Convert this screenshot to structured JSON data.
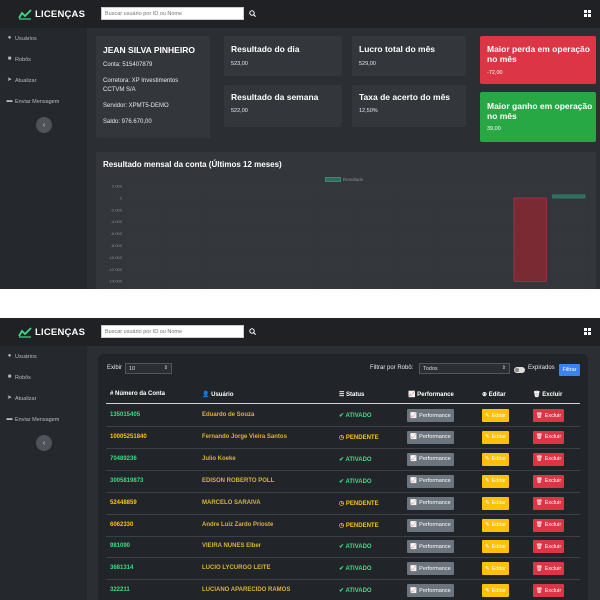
{
  "brand": {
    "name": "LICENÇAS"
  },
  "search": {
    "placeholder": "Buscar usuário por ID ou Nome"
  },
  "sidebar": {
    "items": [
      {
        "icon": "users-icon",
        "label": "Usuários"
      },
      {
        "icon": "robot-icon",
        "label": "Robôs"
      },
      {
        "icon": "send-icon",
        "label": "Atualizar"
      },
      {
        "icon": "message-icon",
        "label": "Enviar Mensagem"
      }
    ],
    "collapse_icon": "‹"
  },
  "account": {
    "name": "JEAN SILVA PINHEIRO",
    "conta": "Conta: 515407879",
    "corretora1": "Corretora: XP Investimentos",
    "corretora2": "CCTVM S/A",
    "servidor": "Servidor: XPMT5-DEMO",
    "saldo": "Saldo: 976.670,00"
  },
  "stats": {
    "dia_title": "Resultado do dia",
    "dia_value": "523,00",
    "semana_title": "Resultado da semana",
    "semana_value": "522,00",
    "lucro_title": "Lucro total do mês",
    "lucro_value": "529,00",
    "taxa_title": "Taxa de acerto do mês",
    "taxa_value": "12,50%",
    "perda_title1": "Maior perda em operação",
    "perda_title2": "no mês",
    "perda_value": "-72,00",
    "ganho_title1": "Maior ganho em operação",
    "ganho_title2": "no mês",
    "ganho_value": "39,00"
  },
  "chart_data": {
    "type": "bar",
    "title": "Resultado mensal da conta (Últimos 12 meses)",
    "legend": "Resultado",
    "yticks": [
      "2.000",
      "0",
      "-2.000",
      "-4.000",
      "-6.000",
      "-8.000",
      "-10.000",
      "-12.000",
      "-14.000"
    ],
    "series": [
      {
        "name": "Resultado",
        "values": [
          0,
          0,
          0,
          0,
          0,
          0,
          0,
          0,
          0,
          0,
          -14000,
          529
        ]
      }
    ],
    "colors": {
      "negative": "#7a2a33",
      "positive": "#2c6e5c"
    }
  },
  "table": {
    "exibir_label": "Exibir",
    "exibir_value": "10",
    "filtro_label": "Filtrar por Robô:",
    "filtro_value": "Todos",
    "expirados_label": "Expirados",
    "filtrar_btn": "Filtrar",
    "headers": {
      "conta": "Número da Conta",
      "usuario": "Usuário",
      "status": "Status",
      "performance": "Performance",
      "editar": "Editar",
      "excluir": "Excluir"
    },
    "btn_perf": "Performance",
    "btn_edit": "Editar",
    "btn_del": "Excluir",
    "rows": [
      {
        "conta": "135015405",
        "usuario": "Eduardo de Souza",
        "status": "ATIVADO"
      },
      {
        "conta": "10005251840",
        "usuario": "Fernando Jorge Vieira Santos",
        "status": "PENDENTE"
      },
      {
        "conta": "70489236",
        "usuario": "Julio Koeke",
        "status": "ATIVADO"
      },
      {
        "conta": "3005819873",
        "usuario": "EDISON ROBERTO POLL",
        "status": "ATIVADO"
      },
      {
        "conta": "52448859",
        "usuario": "MARCELO SARAIVA",
        "status": "PENDENTE"
      },
      {
        "conta": "6062330",
        "usuario": "Andre Luiz Zardo Prioste",
        "status": "PENDENTE"
      },
      {
        "conta": "981090",
        "usuario": "VIEIRA NUNES Elber",
        "status": "ATIVADO"
      },
      {
        "conta": "3681314",
        "usuario": "LUCIO LYCURGO LEITE",
        "status": "ATIVADO"
      },
      {
        "conta": "322211",
        "usuario": "LUCIANO APARECIDO RAMOS",
        "status": "ATIVADO"
      }
    ]
  }
}
